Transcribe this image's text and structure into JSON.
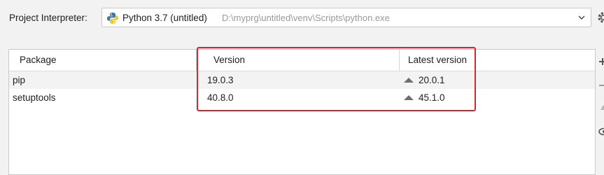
{
  "interpreter": {
    "label": "Project Interpreter:",
    "name": "Python 3.7 (untitled)",
    "path": "D:\\myprg\\untitled\\venv\\Scripts\\python.exe"
  },
  "table": {
    "headers": {
      "package": "Package",
      "version": "Version",
      "latest": "Latest version"
    },
    "rows": [
      {
        "package": "pip",
        "version": "19.0.3",
        "latest": "20.0.1",
        "upgrade_available": true
      },
      {
        "package": "setuptools",
        "version": "40.8.0",
        "latest": "45.1.0",
        "upgrade_available": true
      }
    ]
  },
  "toolbar": {
    "icons": [
      "add-icon",
      "remove-icon",
      "upgrade-icon",
      "eye-icon"
    ]
  },
  "colors": {
    "highlight": "#e0222a",
    "upgrade_arrow": "#6e6e6e",
    "path_text": "#9a9a9a"
  }
}
